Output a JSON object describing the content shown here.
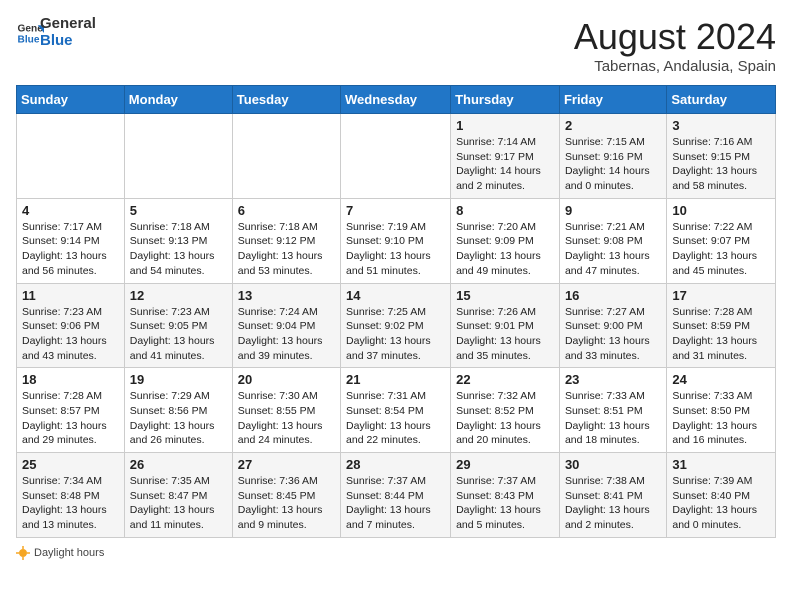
{
  "header": {
    "logo_general": "General",
    "logo_blue": "Blue",
    "month_year": "August 2024",
    "location": "Tabernas, Andalusia, Spain"
  },
  "days_of_week": [
    "Sunday",
    "Monday",
    "Tuesday",
    "Wednesday",
    "Thursday",
    "Friday",
    "Saturday"
  ],
  "weeks": [
    [
      {
        "day": "",
        "info": ""
      },
      {
        "day": "",
        "info": ""
      },
      {
        "day": "",
        "info": ""
      },
      {
        "day": "",
        "info": ""
      },
      {
        "day": "1",
        "info": "Sunrise: 7:14 AM\nSunset: 9:17 PM\nDaylight: 14 hours and 2 minutes."
      },
      {
        "day": "2",
        "info": "Sunrise: 7:15 AM\nSunset: 9:16 PM\nDaylight: 14 hours and 0 minutes."
      },
      {
        "day": "3",
        "info": "Sunrise: 7:16 AM\nSunset: 9:15 PM\nDaylight: 13 hours and 58 minutes."
      }
    ],
    [
      {
        "day": "4",
        "info": "Sunrise: 7:17 AM\nSunset: 9:14 PM\nDaylight: 13 hours and 56 minutes."
      },
      {
        "day": "5",
        "info": "Sunrise: 7:18 AM\nSunset: 9:13 PM\nDaylight: 13 hours and 54 minutes."
      },
      {
        "day": "6",
        "info": "Sunrise: 7:18 AM\nSunset: 9:12 PM\nDaylight: 13 hours and 53 minutes."
      },
      {
        "day": "7",
        "info": "Sunrise: 7:19 AM\nSunset: 9:10 PM\nDaylight: 13 hours and 51 minutes."
      },
      {
        "day": "8",
        "info": "Sunrise: 7:20 AM\nSunset: 9:09 PM\nDaylight: 13 hours and 49 minutes."
      },
      {
        "day": "9",
        "info": "Sunrise: 7:21 AM\nSunset: 9:08 PM\nDaylight: 13 hours and 47 minutes."
      },
      {
        "day": "10",
        "info": "Sunrise: 7:22 AM\nSunset: 9:07 PM\nDaylight: 13 hours and 45 minutes."
      }
    ],
    [
      {
        "day": "11",
        "info": "Sunrise: 7:23 AM\nSunset: 9:06 PM\nDaylight: 13 hours and 43 minutes."
      },
      {
        "day": "12",
        "info": "Sunrise: 7:23 AM\nSunset: 9:05 PM\nDaylight: 13 hours and 41 minutes."
      },
      {
        "day": "13",
        "info": "Sunrise: 7:24 AM\nSunset: 9:04 PM\nDaylight: 13 hours and 39 minutes."
      },
      {
        "day": "14",
        "info": "Sunrise: 7:25 AM\nSunset: 9:02 PM\nDaylight: 13 hours and 37 minutes."
      },
      {
        "day": "15",
        "info": "Sunrise: 7:26 AM\nSunset: 9:01 PM\nDaylight: 13 hours and 35 minutes."
      },
      {
        "day": "16",
        "info": "Sunrise: 7:27 AM\nSunset: 9:00 PM\nDaylight: 13 hours and 33 minutes."
      },
      {
        "day": "17",
        "info": "Sunrise: 7:28 AM\nSunset: 8:59 PM\nDaylight: 13 hours and 31 minutes."
      }
    ],
    [
      {
        "day": "18",
        "info": "Sunrise: 7:28 AM\nSunset: 8:57 PM\nDaylight: 13 hours and 29 minutes."
      },
      {
        "day": "19",
        "info": "Sunrise: 7:29 AM\nSunset: 8:56 PM\nDaylight: 13 hours and 26 minutes."
      },
      {
        "day": "20",
        "info": "Sunrise: 7:30 AM\nSunset: 8:55 PM\nDaylight: 13 hours and 24 minutes."
      },
      {
        "day": "21",
        "info": "Sunrise: 7:31 AM\nSunset: 8:54 PM\nDaylight: 13 hours and 22 minutes."
      },
      {
        "day": "22",
        "info": "Sunrise: 7:32 AM\nSunset: 8:52 PM\nDaylight: 13 hours and 20 minutes."
      },
      {
        "day": "23",
        "info": "Sunrise: 7:33 AM\nSunset: 8:51 PM\nDaylight: 13 hours and 18 minutes."
      },
      {
        "day": "24",
        "info": "Sunrise: 7:33 AM\nSunset: 8:50 PM\nDaylight: 13 hours and 16 minutes."
      }
    ],
    [
      {
        "day": "25",
        "info": "Sunrise: 7:34 AM\nSunset: 8:48 PM\nDaylight: 13 hours and 13 minutes."
      },
      {
        "day": "26",
        "info": "Sunrise: 7:35 AM\nSunset: 8:47 PM\nDaylight: 13 hours and 11 minutes."
      },
      {
        "day": "27",
        "info": "Sunrise: 7:36 AM\nSunset: 8:45 PM\nDaylight: 13 hours and 9 minutes."
      },
      {
        "day": "28",
        "info": "Sunrise: 7:37 AM\nSunset: 8:44 PM\nDaylight: 13 hours and 7 minutes."
      },
      {
        "day": "29",
        "info": "Sunrise: 7:37 AM\nSunset: 8:43 PM\nDaylight: 13 hours and 5 minutes."
      },
      {
        "day": "30",
        "info": "Sunrise: 7:38 AM\nSunset: 8:41 PM\nDaylight: 13 hours and 2 minutes."
      },
      {
        "day": "31",
        "info": "Sunrise: 7:39 AM\nSunset: 8:40 PM\nDaylight: 13 hours and 0 minutes."
      }
    ]
  ],
  "footer": {
    "daylight_label": "Daylight hours"
  }
}
